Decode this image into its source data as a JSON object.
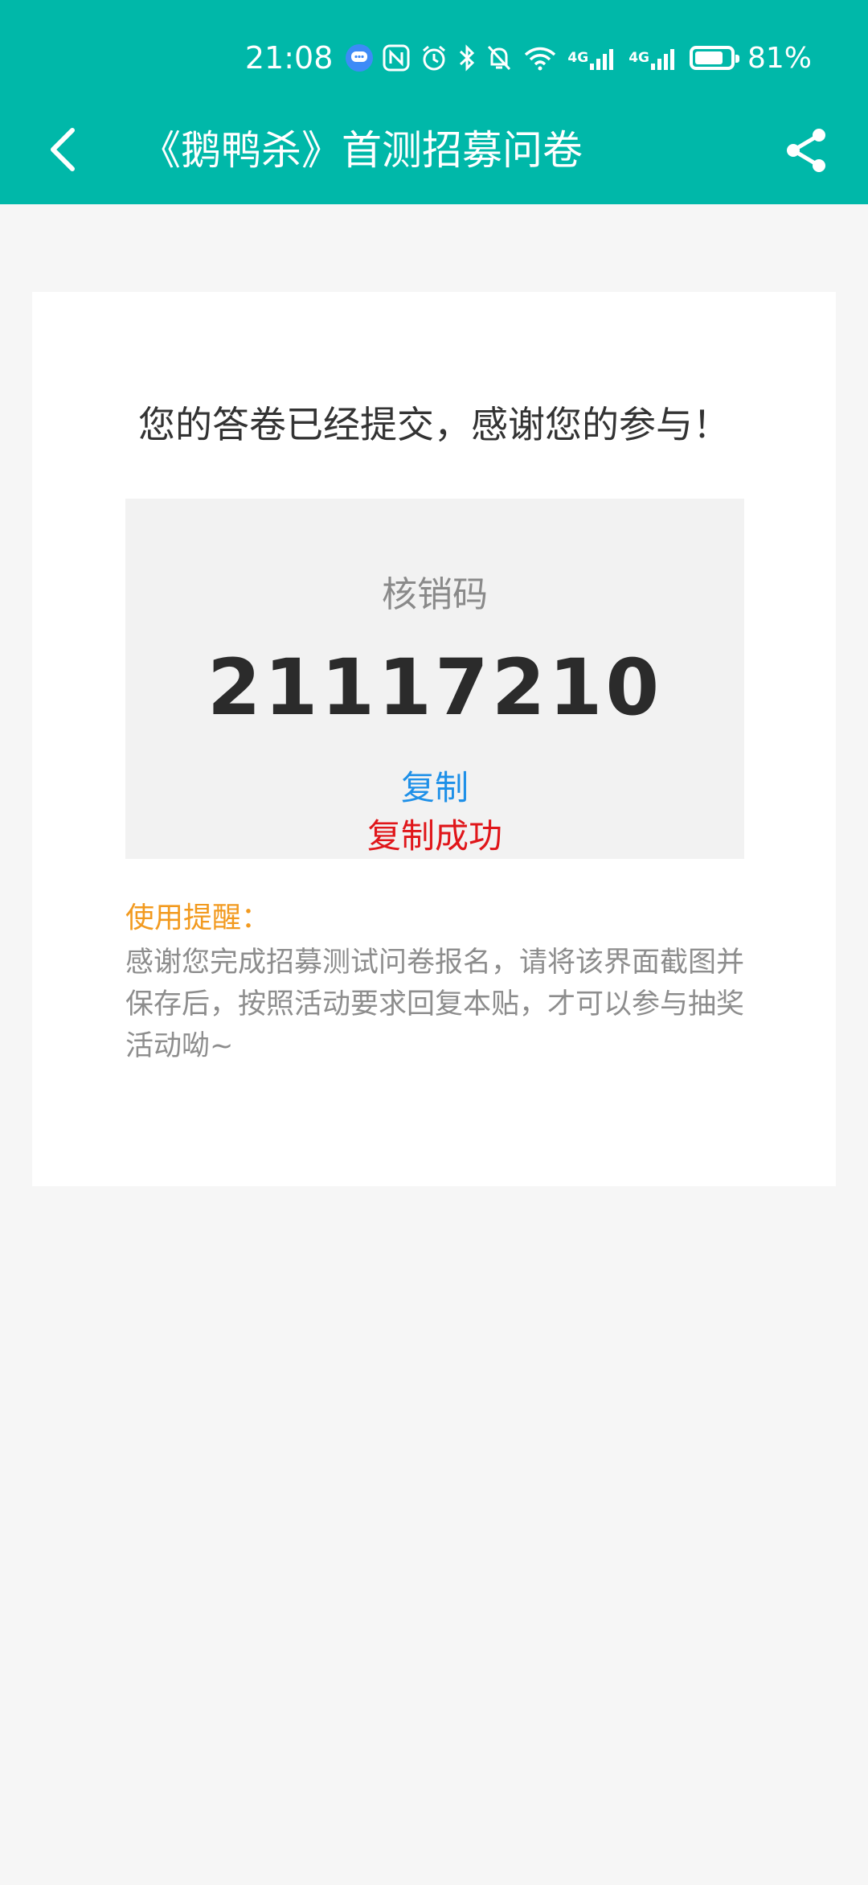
{
  "status_bar": {
    "time": "21:08",
    "network_1": "4G",
    "network_2": "4G",
    "battery": "81%",
    "battery_level": 0.81
  },
  "nav": {
    "title": "《鹅鸭杀》首测招募问卷"
  },
  "result": {
    "message": "您的答卷已经提交，感谢您的参与！",
    "code_label": "核销码",
    "code": "21117210",
    "copy_label": "复制",
    "copy_success": "复制成功"
  },
  "notice": {
    "title": "使用提醒：",
    "body": "感谢您完成招募测试问卷报名，请将该界面截图并保存后，按照活动要求回复本贴，才可以参与抽奖活动呦~"
  },
  "colors": {
    "header": "#00b8a9",
    "copy_link": "#1e90e8",
    "success": "#e0161a",
    "notice_title": "#f29a1f"
  }
}
